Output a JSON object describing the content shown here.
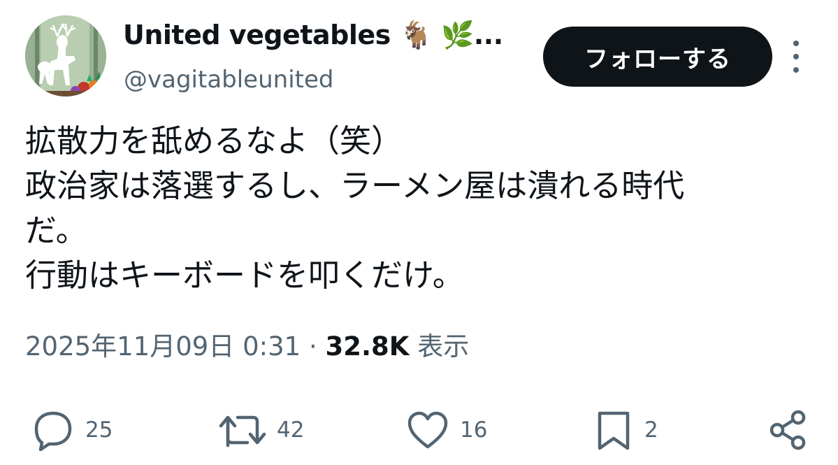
{
  "user": {
    "display_name": "United vegetables 🐐 🌿...",
    "handle": "@vagitableunited"
  },
  "follow_button": {
    "label": "フォローする"
  },
  "tweet": {
    "lines": [
      "拡散力を舐めるなよ（笑）",
      "政治家は落選するし、ラーメン屋は潰れる時代",
      "だ。",
      "行動はキーボードを叩くだけ。"
    ],
    "timestamp": "2025年11月09日 0:31",
    "separator": "·",
    "views_count": "32.8K",
    "views_label": "表示"
  },
  "actions": {
    "reply_count": "25",
    "retweet_count": "42",
    "like_count": "16",
    "bookmark_count": "2"
  },
  "icons": {
    "reply": "reply-bubble-icon",
    "retweet": "retweet-icon",
    "like": "heart-icon",
    "bookmark": "bookmark-icon",
    "share": "share-icon",
    "more": "more-vertical-icon"
  },
  "colors": {
    "text_primary": "#0f1419",
    "text_secondary": "#536471",
    "follow_button_bg": "#0f1419",
    "background": "#ffffff"
  }
}
